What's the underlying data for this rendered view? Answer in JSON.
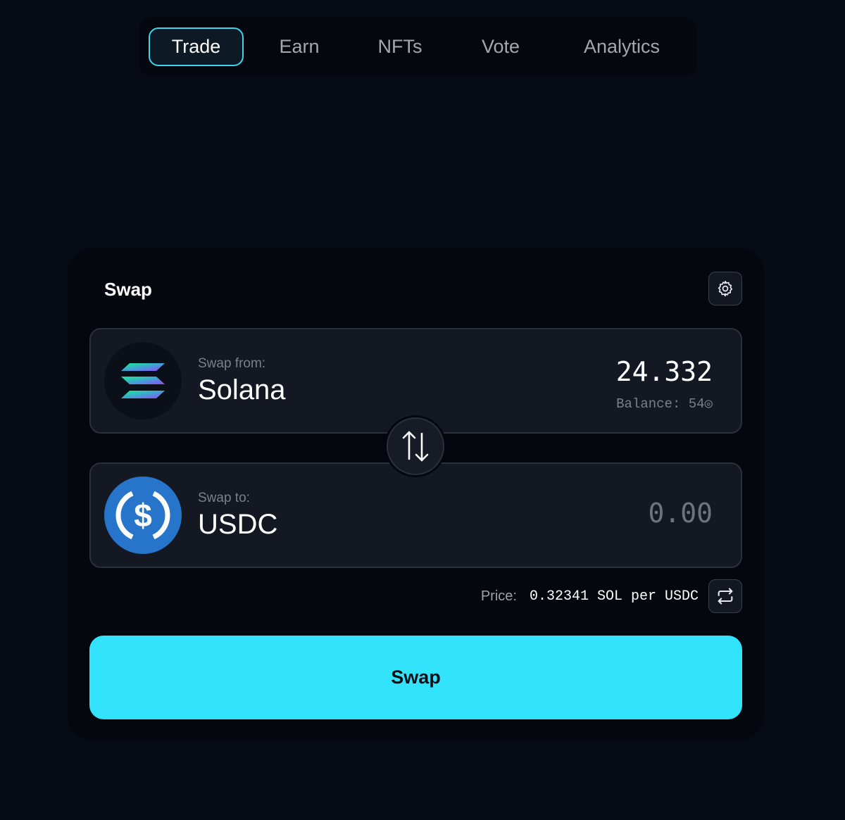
{
  "nav": {
    "tabs": [
      {
        "label": "Trade",
        "active": true
      },
      {
        "label": "Earn",
        "active": false
      },
      {
        "label": "NFTs",
        "active": false
      },
      {
        "label": "Vote",
        "active": false
      },
      {
        "label": "Analytics",
        "active": false
      }
    ]
  },
  "swap_card": {
    "title": "Swap",
    "settings_icon": "gear-icon",
    "from": {
      "caption": "Swap from:",
      "token": "Solana",
      "amount": "24.332",
      "balance": "Balance: 54◎",
      "icon": "solana-logo"
    },
    "switch_icon": "swap-arrows-icon",
    "to": {
      "caption": "Swap to:",
      "token": "USDC",
      "amount_placeholder": "0.00",
      "icon": "usdc-logo"
    },
    "price": {
      "label": "Price:",
      "value": "0.32341 SOL per USDC",
      "toggle_icon": "repeat-icon"
    },
    "submit_label": "Swap"
  },
  "colors": {
    "background": "#070b16",
    "accent": "#33e3fc",
    "active_tab_border": "#3fd4ea",
    "usdc_blue": "#2775ca"
  }
}
